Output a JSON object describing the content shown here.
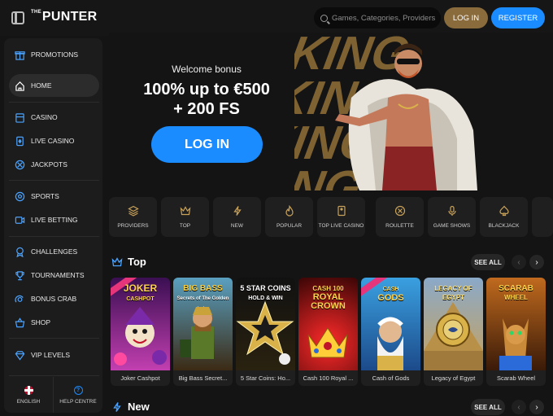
{
  "topbar": {
    "logo": "PUNTER",
    "logo_prefix": "THE",
    "search_placeholder": "Games, Categories, Providers",
    "login_label": "LOG IN",
    "register_label": "REGISTER"
  },
  "sidebar": {
    "items": [
      {
        "label": "PROMOTIONS",
        "icon": "gift-icon"
      },
      {
        "label": "HOME",
        "icon": "home-icon",
        "active": true
      },
      {
        "label": "CASINO",
        "icon": "casino-icon"
      },
      {
        "label": "LIVE CASINO",
        "icon": "live-casino-icon"
      },
      {
        "label": "JACKPOTS",
        "icon": "jackpot-icon"
      },
      {
        "label": "SPORTS",
        "icon": "soccer-ball-icon"
      },
      {
        "label": "LIVE BETTING",
        "icon": "live-betting-icon"
      },
      {
        "label": "CHALLENGES",
        "icon": "medal-icon"
      },
      {
        "label": "TOURNAMENTS",
        "icon": "trophy-icon"
      },
      {
        "label": "BONUS CRAB",
        "icon": "crab-icon"
      },
      {
        "label": "SHOP",
        "icon": "basket-icon"
      },
      {
        "label": "VIP LEVELS",
        "icon": "diamond-icon"
      }
    ],
    "footer": {
      "language": "ENGLISH",
      "help": "HELP CENTRE"
    }
  },
  "hero": {
    "welcome": "Welcome bonus",
    "offer_line1": "100% up to €500",
    "offer_line2": "+ 200 FS",
    "login_label": "LOG IN"
  },
  "categories": [
    {
      "label": "PROVIDERS",
      "icon": "layers-icon"
    },
    {
      "label": "TOP",
      "icon": "crown-icon"
    },
    {
      "label": "NEW",
      "icon": "lightning-icon"
    },
    {
      "label": "POPULAR",
      "icon": "flame-icon"
    },
    {
      "label": "TOP LIVE CASINO",
      "icon": "card-icon"
    },
    {
      "label": "ROULETTE",
      "icon": "roulette-icon"
    },
    {
      "label": "GAME SHOWS",
      "icon": "microphone-icon"
    },
    {
      "label": "BLACKJACK",
      "icon": "spade-icon"
    }
  ],
  "sections": {
    "top": {
      "title": "Top",
      "see_all": "SEE ALL"
    },
    "new": {
      "title": "New",
      "see_all": "SEE ALL"
    }
  },
  "games": [
    {
      "name": "Joker Cashpot",
      "art_title": "JOKER CASHPOT",
      "colors": [
        "#5a1a6e",
        "#c23fb0"
      ]
    },
    {
      "name": "Big Bass Secret...",
      "art_title": "BIG BASS Secrets of The Golden Lake",
      "colors": [
        "#3b2a14",
        "#8a5a24"
      ]
    },
    {
      "name": "5 Star Coins: Ho...",
      "art_title": "5 STAR COINS HOLD & WIN",
      "colors": [
        "#1a1a1a",
        "#b8902a"
      ]
    },
    {
      "name": "Cash 100 Royal ...",
      "art_title": "CASH 100 ROYAL CROWN",
      "colors": [
        "#5a0a0a",
        "#c01a1a"
      ]
    },
    {
      "name": "Cash of Gods",
      "art_title": "CASH OF GODS",
      "colors": [
        "#1c4a8a",
        "#3aa0e0"
      ]
    },
    {
      "name": "Legacy of Egypt",
      "art_title": "LEGACY OF EGYPT",
      "colors": [
        "#8aa9c9",
        "#c9a25a"
      ]
    },
    {
      "name": "Scarab Wheel",
      "art_title": "SCARAB WHEEL",
      "colors": [
        "#6a2a0e",
        "#c06a1e"
      ]
    }
  ],
  "colors": {
    "accent_blue": "#1a8cff",
    "accent_gold": "#8a6b3c",
    "background": "#141414",
    "panel": "#1c1c1c"
  }
}
